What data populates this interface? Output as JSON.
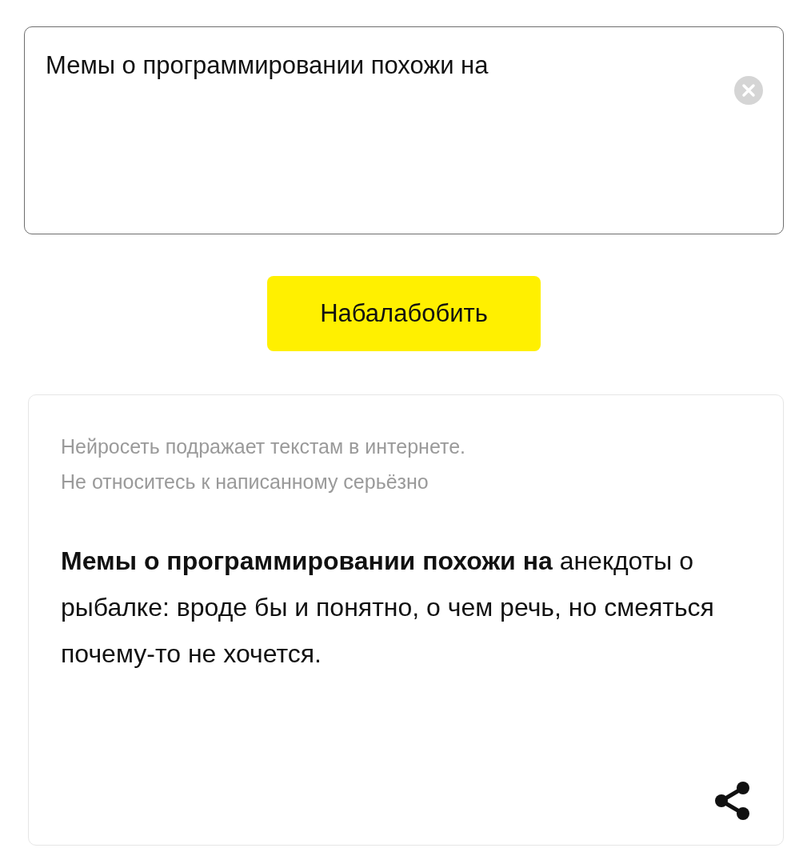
{
  "query": {
    "value": "Мемы о программировании похожи на"
  },
  "generate_button": {
    "label": "Набалабобить"
  },
  "result": {
    "disclaimer": [
      "Нейросеть подражает текстам в интернете.",
      "Не относитесь к написанному серьёзно"
    ],
    "text": "**Мемы о программировании похожи на** анекдоты о рыбалке: вроде бы и понятно, о чем речь, но смеяться почему-то не хочется."
  }
}
